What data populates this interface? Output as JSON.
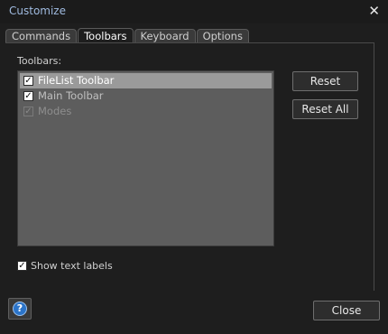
{
  "window": {
    "title": "Customize",
    "close_glyph": "✕"
  },
  "tabs": [
    {
      "label": "Commands",
      "active": false
    },
    {
      "label": "Toolbars",
      "active": true
    },
    {
      "label": "Keyboard",
      "active": false
    },
    {
      "label": "Options",
      "active": false
    }
  ],
  "toolbars_label": "Toolbars:",
  "toolbars": [
    {
      "label": "FileList Toolbar",
      "checked": true,
      "selected": true,
      "enabled": true
    },
    {
      "label": "Main Toolbar",
      "checked": true,
      "selected": false,
      "enabled": true
    },
    {
      "label": "Modes",
      "checked": true,
      "selected": false,
      "enabled": false
    }
  ],
  "buttons": {
    "reset": "Reset",
    "reset_all": "Reset All",
    "close": "Close"
  },
  "show_text_labels": {
    "label": "Show text labels",
    "checked": true
  },
  "help": {
    "glyph": "?"
  },
  "colors": {
    "title": "#9fbadf",
    "selection": "#9a9a9a",
    "listbox": "#5d5d5d",
    "help_icon": "#2b74c9"
  },
  "icons": {
    "close": "close-icon",
    "help": "help-icon",
    "check": "checkbox-check-icon"
  }
}
